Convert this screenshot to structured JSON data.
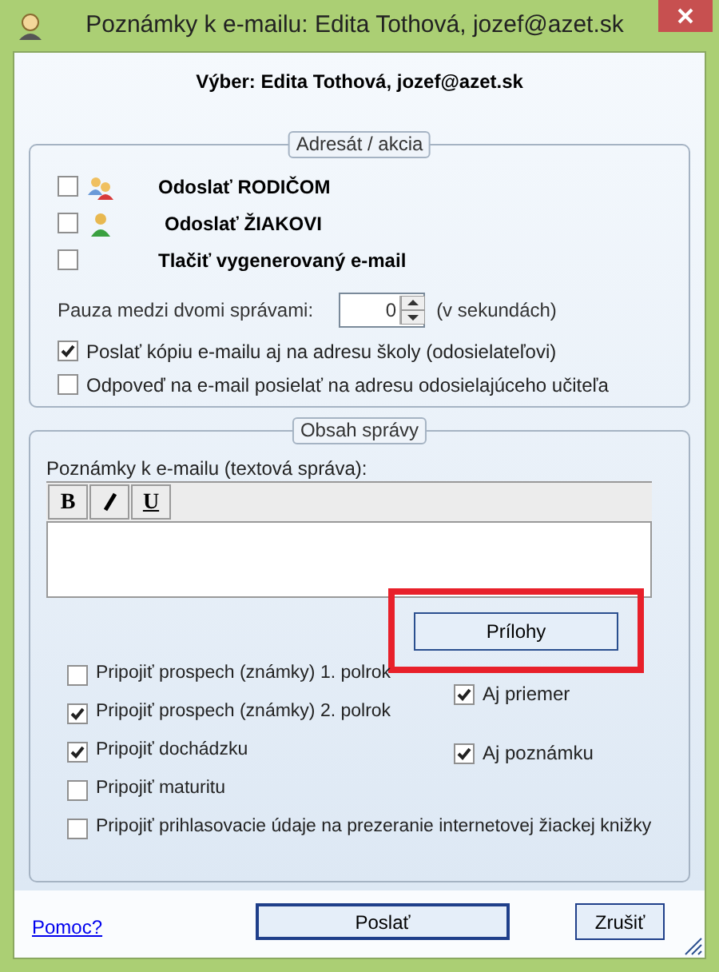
{
  "window": {
    "title": "Poznámky k e-mailu: Edita Tothová, jozef@azet.sk"
  },
  "selection": "Výber: Edita Tothová, jozef@azet.sk",
  "recipient_group": {
    "legend": "Adresát / akcia",
    "send_options": [
      {
        "label": "Odoslať RODIČOM",
        "checked": false,
        "kind": "parents"
      },
      {
        "label": "Odoslať ŽIAKOVI",
        "checked": false,
        "kind": "student"
      },
      {
        "label": "Tlačiť vygenerovaný e-mail",
        "checked": false,
        "kind": "print"
      }
    ],
    "pause": {
      "label": "Pauza medzi dvomi správami:",
      "value": "0",
      "unit": "(v sekundách)"
    },
    "options": [
      {
        "label": "Poslať kópiu e-mailu aj na adresu školy (odosielateľovi)",
        "checked": true
      },
      {
        "label": "Odpoveď na e-mail posielať na adresu odosielajúceho učiteľa",
        "checked": false
      }
    ]
  },
  "content_group": {
    "legend": "Obsah správy",
    "notes_label": "Poznámky k e-mailu (textová správa):",
    "format_buttons": [
      {
        "kind": "bold",
        "label": "B"
      },
      {
        "kind": "italic"
      },
      {
        "kind": "underline",
        "label": "U"
      }
    ],
    "attachments_button": {
      "label": "Prílohy",
      "highlighted": true
    },
    "attach_options": [
      {
        "label": "Pripojiť prospech (známky) 1. polrok",
        "checked": false
      },
      {
        "label": "Pripojiť prospech (známky) 2. polrok",
        "checked": true
      },
      {
        "label": "Pripojiť dochádzku",
        "checked": true
      },
      {
        "label": "Pripojiť maturitu",
        "checked": false
      },
      {
        "label": "Pripojiť prihlasovacie údaje na prezeranie internetovej žiackej knižky",
        "checked": false
      }
    ],
    "extra_options": [
      {
        "label": "Aj priemer",
        "checked": true
      },
      {
        "label": "Aj poznámku",
        "checked": true
      }
    ]
  },
  "footer": {
    "help_link": "Pomoc?",
    "send_button": "Poslať",
    "cancel_button": "Zrušiť"
  }
}
